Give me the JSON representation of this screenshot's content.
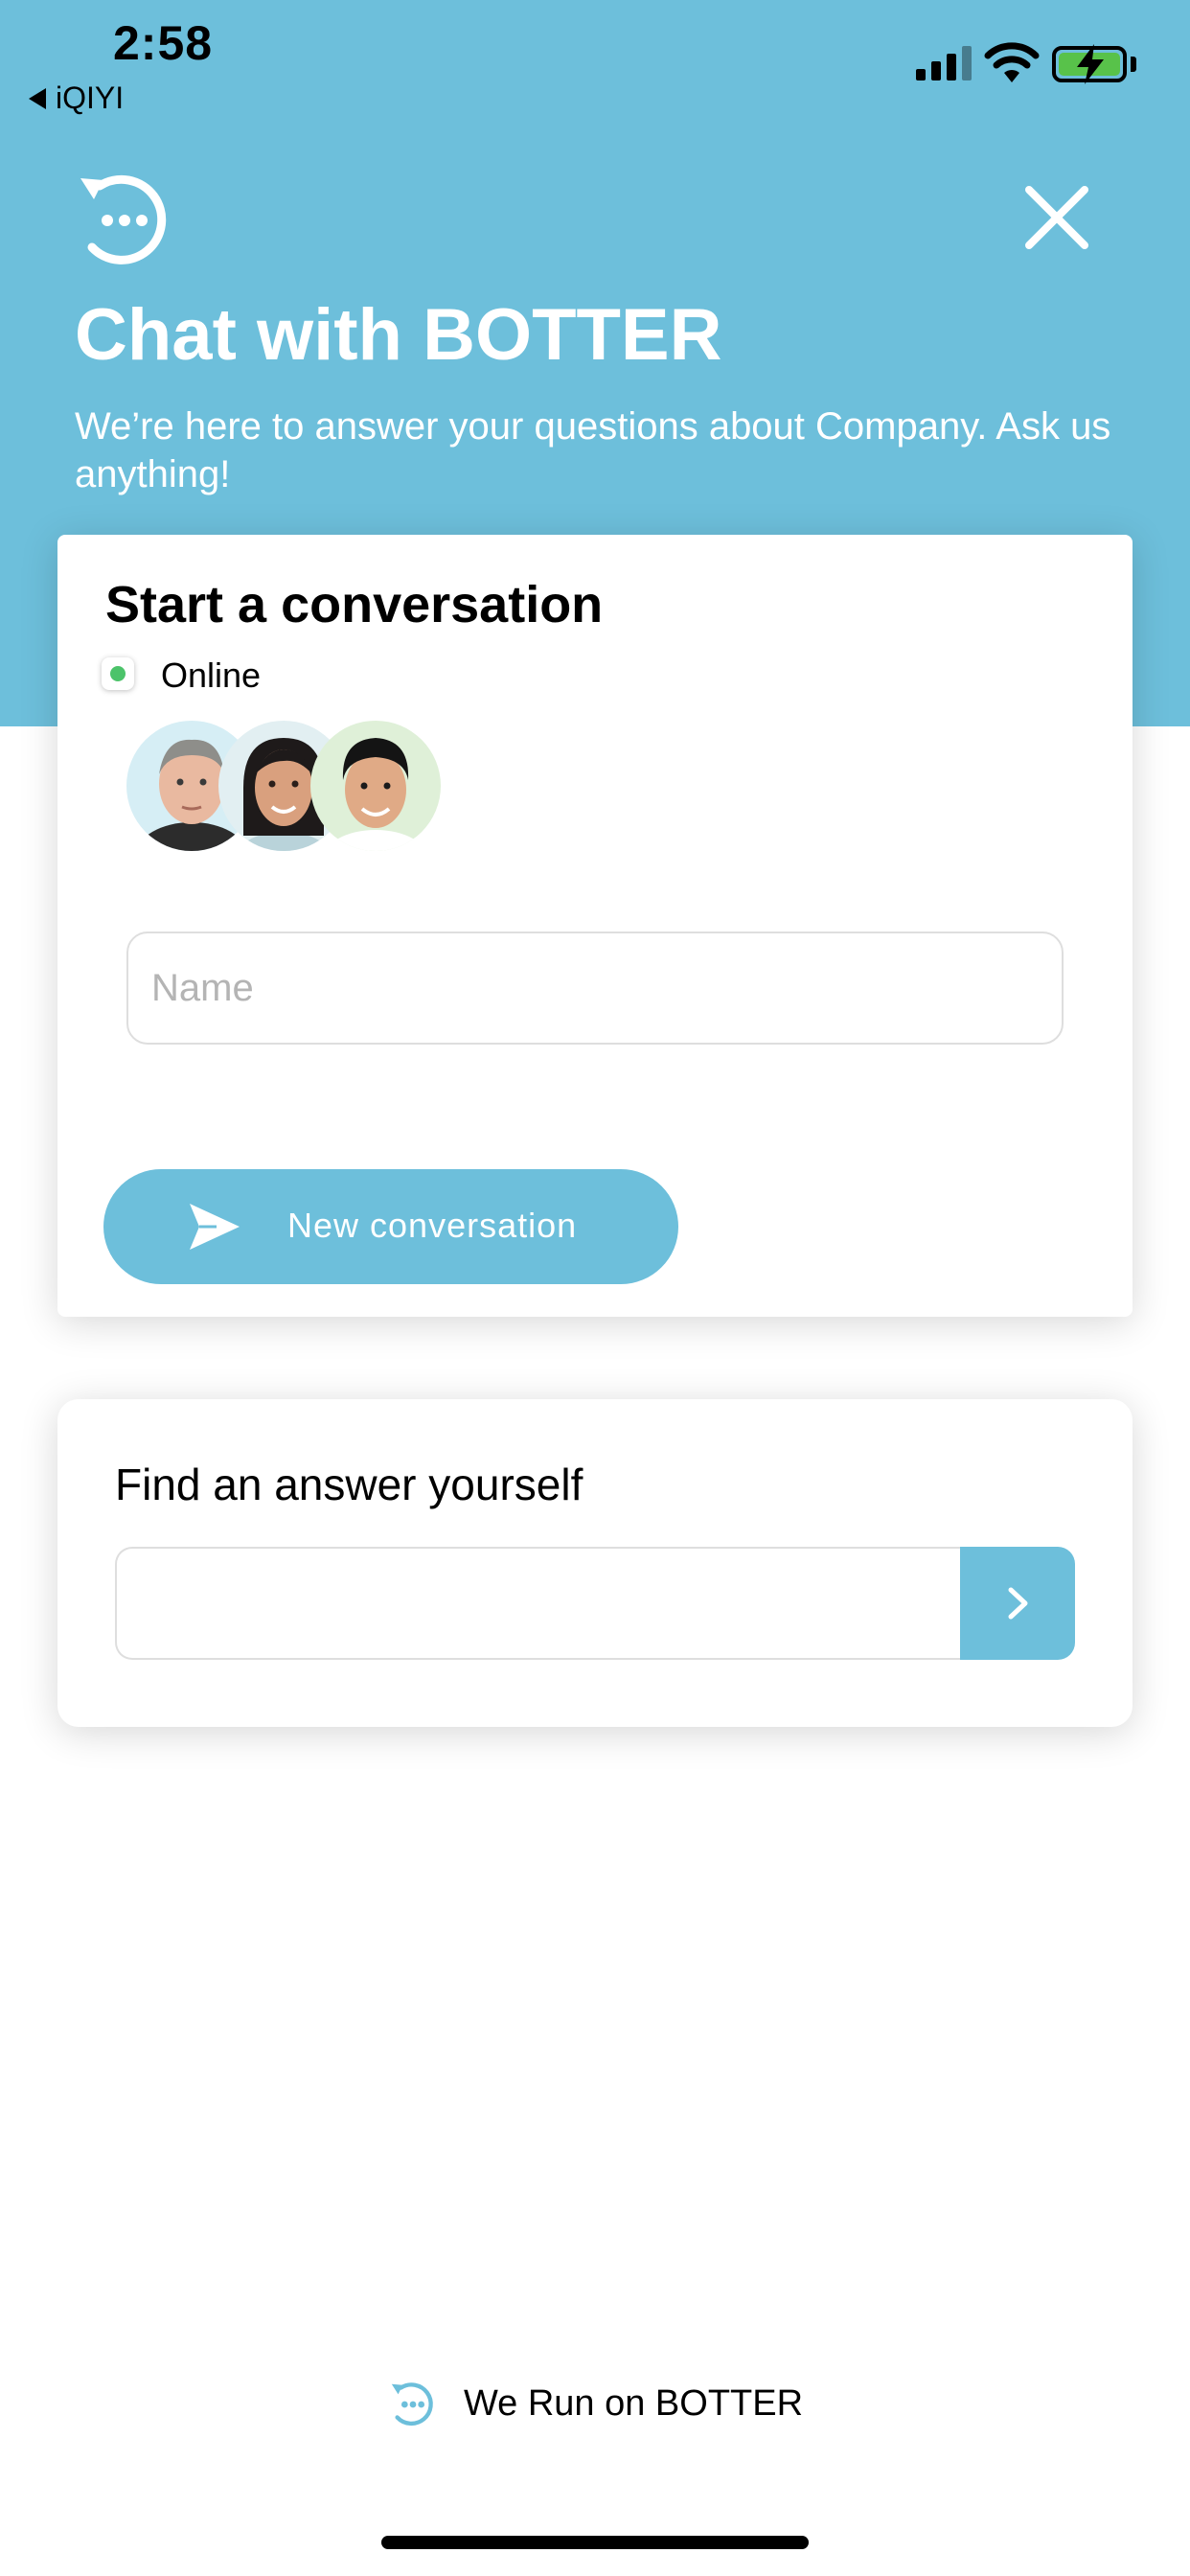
{
  "status_bar": {
    "time": "2:58",
    "back_app": "iQIYI"
  },
  "header": {
    "title": "Chat with BOTTER",
    "subtitle": "We’re here to answer your questions about Company. Ask us anything!",
    "logo_icon": "chat-bubble-refresh-icon",
    "close_icon": "close-icon"
  },
  "conversation_card": {
    "title": "Start a conversation",
    "status": "Online",
    "name_placeholder": "Name",
    "button_label": "New conversation",
    "button_icon": "send-icon"
  },
  "find_card": {
    "title": "Find an answer yourself",
    "search_value": "",
    "button_icon": "chevron-right-icon"
  },
  "footer": {
    "label": "We Run on BOTTER"
  },
  "colors": {
    "brand": "#6dbfdb",
    "online": "#4cc36a",
    "battery": "#58c24a"
  }
}
